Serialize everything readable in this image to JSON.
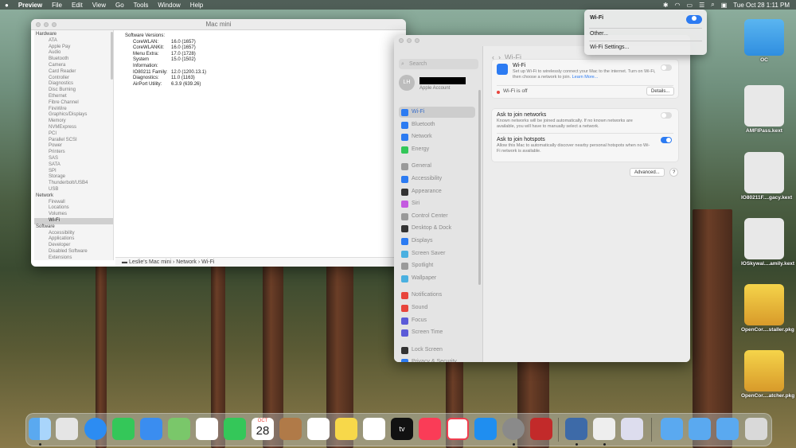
{
  "menubar": {
    "apple": "",
    "app": "Preview",
    "items": [
      "File",
      "Edit",
      "View",
      "Go",
      "Tools",
      "Window",
      "Help"
    ],
    "clock": "Tue Oct 28  1:11 PM"
  },
  "sysinfo": {
    "title": "Mac mini",
    "tree": [
      {
        "t": "Hardware",
        "g": true
      },
      {
        "t": "ATA"
      },
      {
        "t": "Apple Pay"
      },
      {
        "t": "Audio"
      },
      {
        "t": "Bluetooth"
      },
      {
        "t": "Camera"
      },
      {
        "t": "Card Reader"
      },
      {
        "t": "Controller"
      },
      {
        "t": "Diagnostics"
      },
      {
        "t": "Disc Burning"
      },
      {
        "t": "Ethernet"
      },
      {
        "t": "Fibre Channel"
      },
      {
        "t": "FireWire"
      },
      {
        "t": "Graphics/Displays"
      },
      {
        "t": "Memory"
      },
      {
        "t": "NVMExpress"
      },
      {
        "t": "PCI"
      },
      {
        "t": "Parallel SCSI"
      },
      {
        "t": "Power"
      },
      {
        "t": "Printers"
      },
      {
        "t": "SAS"
      },
      {
        "t": "SATA"
      },
      {
        "t": "SPI"
      },
      {
        "t": "Storage"
      },
      {
        "t": "Thunderbolt/USB4"
      },
      {
        "t": "USB"
      },
      {
        "t": "Network",
        "g": true
      },
      {
        "t": "Firewall"
      },
      {
        "t": "Locations"
      },
      {
        "t": "Volumes"
      },
      {
        "t": "Wi-Fi",
        "sel": true
      },
      {
        "t": "Software",
        "g": true
      },
      {
        "t": "Accessibility"
      },
      {
        "t": "Applications"
      },
      {
        "t": "Developer"
      },
      {
        "t": "Disabled Software"
      },
      {
        "t": "Extensions"
      },
      {
        "t": "Fonts"
      }
    ],
    "heading": "Software Versions:",
    "versions": [
      [
        "CoreWLAN:",
        "16.0 (1657)"
      ],
      [
        "CoreWLANKit:",
        "16.0 (1657)"
      ],
      [
        "Menu Extra:",
        "17.0 (1728)"
      ],
      [
        "System Information:",
        "15.0 (1502)"
      ],
      [
        "IO80211 Family:",
        "12.0 (1200.13.1)"
      ],
      [
        "Diagnostics:",
        "11.0 (1163)"
      ],
      [
        "AirPort Utility:",
        "6.3.9 (639.26)"
      ]
    ],
    "path": "Leslie's Mac mini  ›  Network  ›  Wi-Fi"
  },
  "settings": {
    "search": "Search",
    "initials": "LH",
    "account_label": "Apple Account",
    "header": "Wi-Fi",
    "nav": [
      {
        "t": "Wi-Fi",
        "c": "#2c7bf2",
        "sel": true
      },
      {
        "t": "Bluetooth",
        "c": "#2c7bf2"
      },
      {
        "t": "Network",
        "c": "#2c7bf2"
      },
      {
        "t": "Energy",
        "c": "#33c759"
      },
      {
        "t": "General",
        "c": "#9a9a9a",
        "gap": true
      },
      {
        "t": "Accessibility",
        "c": "#2c7bf2"
      },
      {
        "t": "Appearance",
        "c": "#333"
      },
      {
        "t": "Siri",
        "c": "#c45ae0"
      },
      {
        "t": "Control Center",
        "c": "#9a9a9a"
      },
      {
        "t": "Desktop & Dock",
        "c": "#333"
      },
      {
        "t": "Displays",
        "c": "#2c7bf2"
      },
      {
        "t": "Screen Saver",
        "c": "#4ab0e0"
      },
      {
        "t": "Spotlight",
        "c": "#9a9a9a"
      },
      {
        "t": "Wallpaper",
        "c": "#4ab0e0"
      },
      {
        "t": "Notifications",
        "c": "#e8453c",
        "gap": true
      },
      {
        "t": "Sound",
        "c": "#e8453c"
      },
      {
        "t": "Focus",
        "c": "#5a5ad8"
      },
      {
        "t": "Screen Time",
        "c": "#5a5ad8"
      },
      {
        "t": "Lock Screen",
        "c": "#333",
        "gap": true
      },
      {
        "t": "Privacy & Security",
        "c": "#2c7bf2"
      }
    ],
    "wifi_title": "Wi-Fi",
    "wifi_desc": "Set up Wi-Fi to wirelessly connect your Mac to the internet. Turn on Wi-Fi, then choose a network to join.",
    "learn": "Learn More...",
    "wifi_off": "Wi-Fi is off",
    "details": "Details...",
    "ask_networks": "Ask to join networks",
    "ask_networks_desc": "Known networks will be joined automatically. If no known networks are available, you will have to manually select a network.",
    "ask_hotspots": "Ask to join hotspots",
    "ask_hotspots_desc": "Allow this Mac to automatically discover nearby personal hotspots when no Wi-Fi network is available.",
    "advanced": "Advanced...",
    "help": "?"
  },
  "wifimenu": {
    "title": "Wi-Fi",
    "other": "Other...",
    "settings": "Wi-Fi Settings..."
  },
  "desktop": [
    "OC",
    "AMFIPass.kext",
    "IO80211F....gacy.kext",
    "IOSkywal....amily.kext",
    "OpenCor....staller.pkg",
    "OpenCor....atcher.pkg"
  ],
  "dock": {
    "cal_month": "OCT",
    "cal_day": "28",
    "tv": "tv"
  }
}
